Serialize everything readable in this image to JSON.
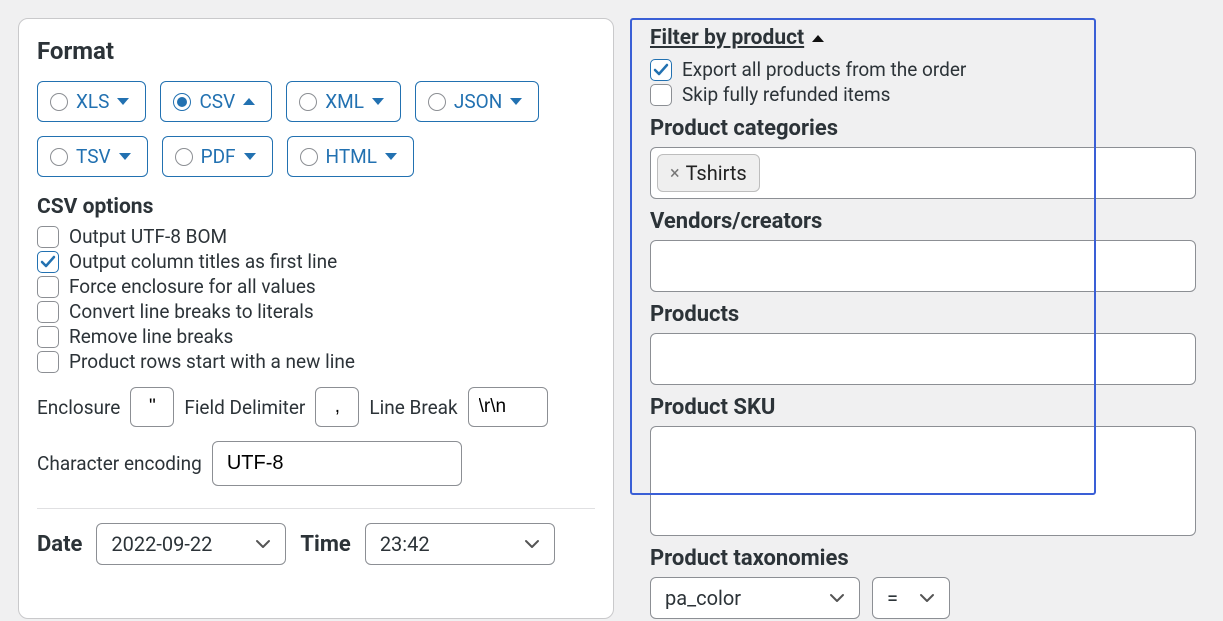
{
  "format": {
    "heading": "Format",
    "options": {
      "xls": "XLS",
      "csv": "CSV",
      "xml": "XML",
      "json": "JSON",
      "tsv": "TSV",
      "pdf": "PDF",
      "html": "HTML"
    },
    "selected": "csv"
  },
  "csv_options": {
    "heading": "CSV options",
    "utf8_bom": "Output UTF-8 BOM",
    "column_titles": "Output column titles as first line",
    "force_enclosure": "Force enclosure for all values",
    "convert_line_breaks": "Convert line breaks to literals",
    "remove_line_breaks": "Remove line breaks",
    "product_rows_newline": "Product rows start with a new line",
    "enclosure_label": "Enclosure",
    "enclosure_value": "\"",
    "field_delimiter_label": "Field Delimiter",
    "field_delimiter_value": ",",
    "line_break_label": "Line Break",
    "line_break_value": "\\r\\n",
    "encoding_label": "Character encoding",
    "encoding_value": "UTF-8"
  },
  "datetime": {
    "date_label": "Date",
    "date_value": "2022-09-22",
    "time_label": "Time",
    "time_value": "23:42"
  },
  "filter": {
    "title": "Filter by product",
    "export_all_label": "Export all products from the order",
    "skip_refunded_label": "Skip fully refunded items",
    "product_categories_label": "Product categories",
    "categories_tags": [
      "Tshirts"
    ],
    "vendors_label": "Vendors/creators",
    "products_label": "Products",
    "product_sku_label": "Product SKU",
    "taxonomies_label": "Product taxonomies",
    "taxonomy_value": "pa_color",
    "taxonomy_op": "="
  }
}
